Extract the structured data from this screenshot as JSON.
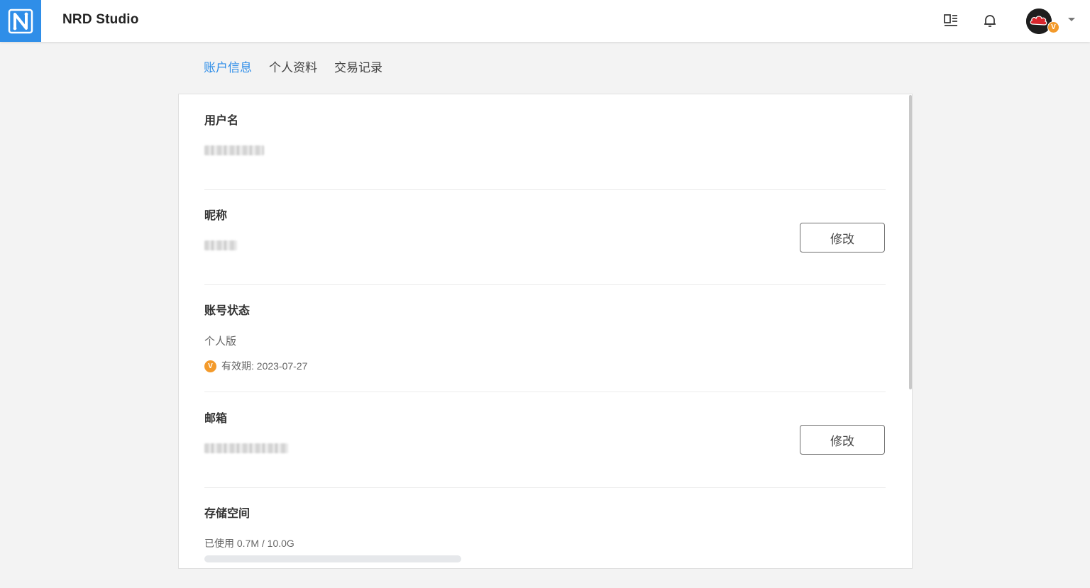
{
  "header": {
    "app_title": "NRD Studio",
    "logo_letter": "N",
    "avatar_badge": "V",
    "brand_color": "#2f8ee8",
    "icons": [
      "layout-icon",
      "bell-icon",
      "chevron-down-icon"
    ]
  },
  "tabs": [
    {
      "label": "账户信息",
      "active": true
    },
    {
      "label": "个人资料",
      "active": false
    },
    {
      "label": "交易记录",
      "active": false
    }
  ],
  "account": {
    "username": {
      "label": "用户名"
    },
    "nickname": {
      "label": "昵称",
      "edit_label": "修改"
    },
    "status": {
      "label": "账号状态",
      "plan": "个人版",
      "vip_badge": "V",
      "validity": "有效期: 2023-07-27",
      "badge_color": "#f39a2b"
    },
    "email": {
      "label": "邮箱",
      "edit_label": "修改"
    },
    "storage": {
      "label": "存储空间",
      "usage_text": "已使用 0.7M / 10.0G",
      "used_fraction": 7e-05
    }
  }
}
